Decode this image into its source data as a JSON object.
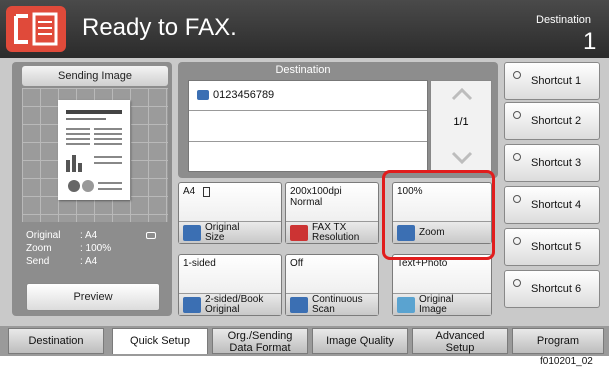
{
  "header": {
    "title": "Ready to FAX.",
    "destination_label": "Destination",
    "destination_count": "1"
  },
  "left": {
    "sending_tab": "Sending Image",
    "info": [
      {
        "label": "Original",
        "value": ": A4"
      },
      {
        "label": "Zoom",
        "value": ": 100%"
      },
      {
        "label": "Send",
        "value": ": A4"
      }
    ],
    "preview_button": "Preview"
  },
  "destination": {
    "header": "Destination",
    "entries": [
      "0123456789",
      "",
      ""
    ],
    "page_indicator": "1/1"
  },
  "functions": {
    "original_size": {
      "value": "A4",
      "label": "Original\nSize"
    },
    "fax_resolution": {
      "value": "200x100dpi\nNormal",
      "label": "FAX TX\nResolution"
    },
    "zoom": {
      "value": "100%",
      "label": "Zoom"
    },
    "duplex": {
      "value": "1-sided",
      "label": "2-sided/Book\nOriginal"
    },
    "continuous_scan": {
      "value": "Off",
      "label": "Continuous\nScan"
    },
    "original_image": {
      "value": "Text+Photo",
      "label": "Original\nImage"
    }
  },
  "shortcuts": [
    "Shortcut 1",
    "Shortcut 2",
    "Shortcut 3",
    "Shortcut 4",
    "Shortcut 5",
    "Shortcut 6"
  ],
  "tabs": [
    "Destination",
    "Quick Setup",
    "Org./Sending\nData Format",
    "Image Quality",
    "Advanced\nSetup",
    "Program"
  ],
  "active_tab": "Quick Setup",
  "footer_code": "f010201_02",
  "colors": {
    "header_bg": "#333333",
    "panel_bg": "#c9c9c9",
    "highlight": "#e11d1d",
    "fax_icon": "#e04a3a"
  }
}
